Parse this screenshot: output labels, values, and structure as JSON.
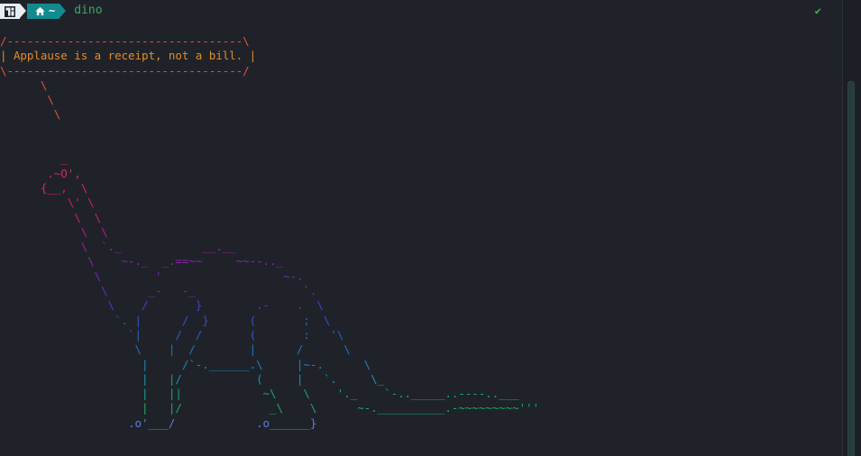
{
  "prompt": {
    "os_icon": "manjaro-logo-icon",
    "home_icon": "home-icon",
    "path": "~",
    "command": "dino",
    "status_symbol": "✔"
  },
  "colors": {
    "os_segment": "#e6edf3",
    "path_segment": "#138a8d",
    "command": "#3fa66a",
    "status_ok": "#3fb950"
  },
  "output_lines": [
    {
      "text": "/-----------------------------------\\",
      "color": "#e8503a"
    },
    {
      "text": "| Applause is a receipt, not a bill. |",
      "color": "#e58a2a"
    },
    {
      "text": "\\-----------------------------------/",
      "color": "#e8503a"
    },
    {
      "text": "      \\",
      "color": "#e8503a"
    },
    {
      "text": "       \\",
      "color": "#e8503a"
    },
    {
      "text": "        \\",
      "color": "#e8503a"
    },
    {
      "text": "",
      "color": "#e8503a"
    },
    {
      "text": "",
      "color": "#e8503a"
    },
    {
      "text": "         _",
      "color": "#d8285a"
    },
    {
      "text": "       .~O',",
      "color": "#d8285a"
    },
    {
      "text": "      {__,  \\",
      "color": "#d8285a"
    },
    {
      "text": "          \\' \\",
      "color": "#c8207a"
    },
    {
      "text": "           \\  \\",
      "color": "#c8207a"
    },
    {
      "text": "            \\  \\",
      "color": "#b21e8e"
    },
    {
      "text": "            \\  `._            __.__",
      "color": "#a21aa0"
    },
    {
      "text": "             \\    ~-._  _.==~~     ~~--.._",
      "color": "#8e1fb0"
    },
    {
      "text": "              \\        '                  ~-.",
      "color": "#7a24bc"
    },
    {
      "text": "               \\      _-   -_                `.",
      "color": "#6a2bc8"
    },
    {
      "text": "                \\    /       }        .-    .  \\",
      "color": "#4e3acc"
    },
    {
      "text": "                 `. |      /  }      (       ;  \\",
      "color": "#3a4ccc"
    },
    {
      "text": "                   `|     /  /       (       :   '\\",
      "color": "#2b5ec8"
    },
    {
      "text": "                    \\    |  /        |      /      \\",
      "color": "#1f72c4"
    },
    {
      "text": "                     |     /`-.______.\\     |~-.      \\",
      "color": "#1a86b8"
    },
    {
      "text": "                     |   |/           (     |   `.     \\_",
      "color": "#1696a8"
    },
    {
      "text": "                     |   ||            ~\\    \\    '._    `-.._____..----..___",
      "color": "#14a08c"
    },
    {
      "text": "                     |   |/             _\\    \\      ~-.__________.-~~~~~~~~~'''",
      "color": "#1ca866"
    },
    {
      "text": "                   .o'___/            .o______}",
      "color": "#5f7adc"
    }
  ]
}
